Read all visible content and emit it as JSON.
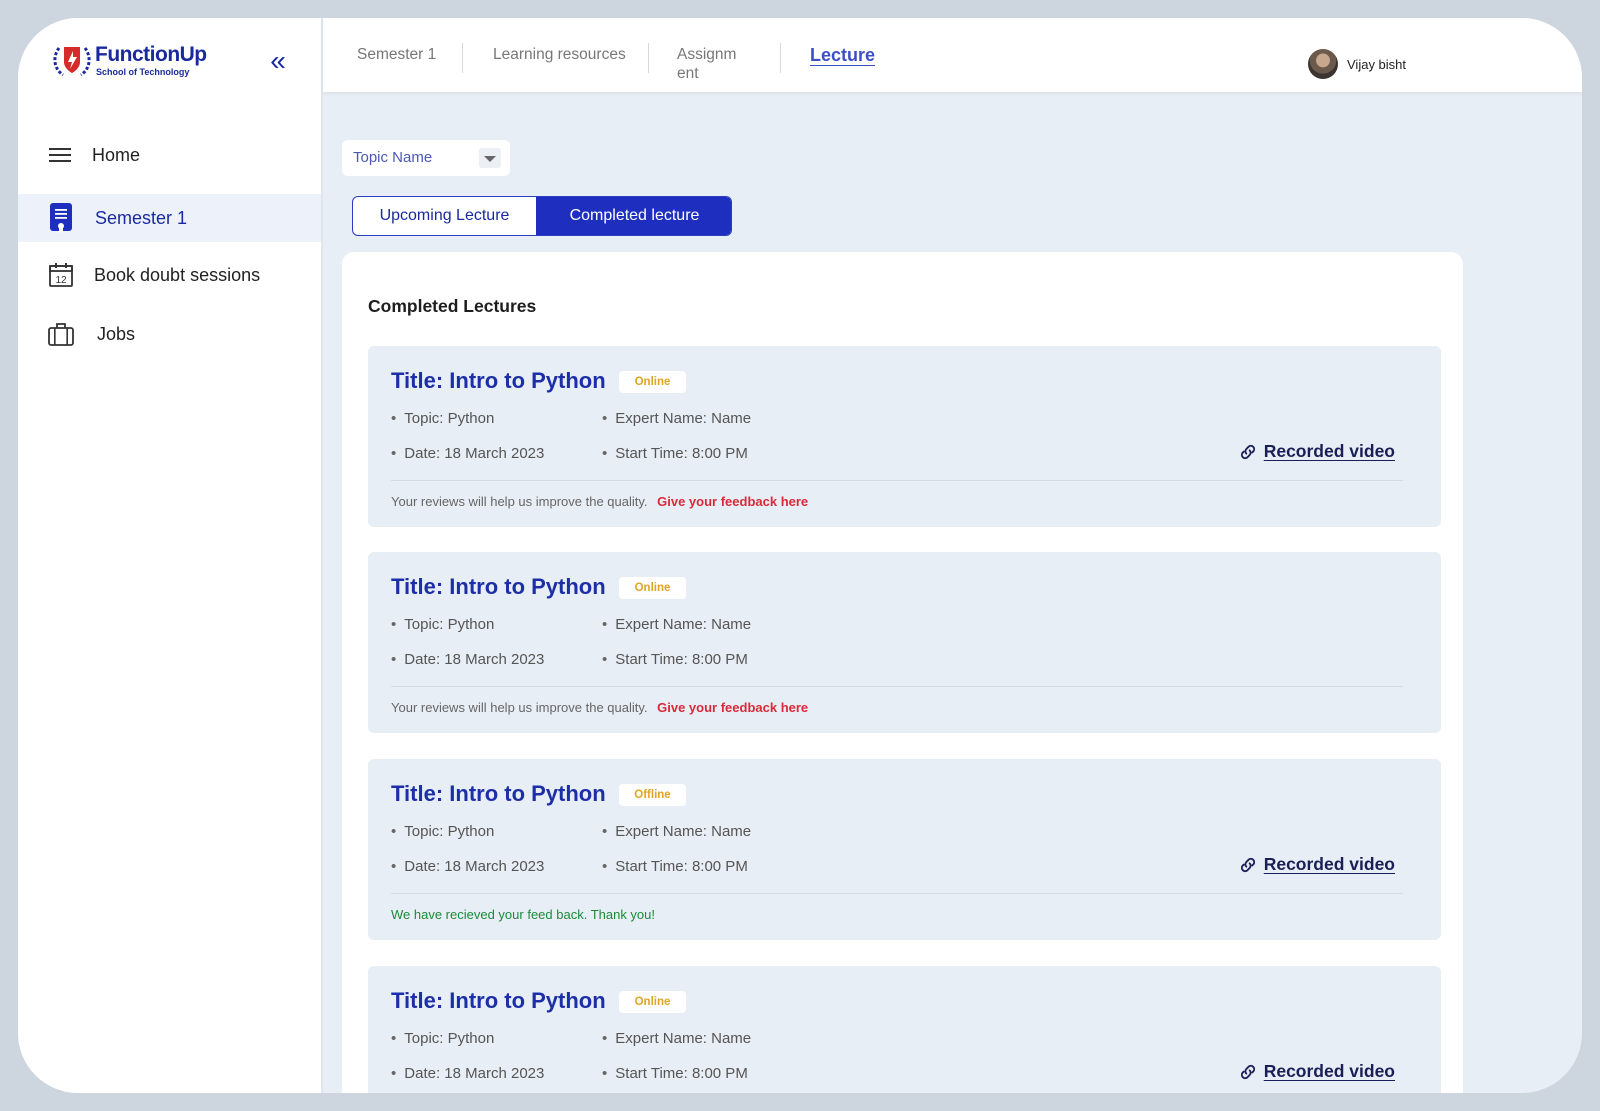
{
  "brand": {
    "name": "FunctionUp",
    "tagline": "School of Technology"
  },
  "sidebar": {
    "collapse_symbol": "«",
    "items": [
      {
        "label": "Home",
        "icon": "menu-icon",
        "active": false
      },
      {
        "label": "Semester 1",
        "icon": "semester-icon",
        "active": true
      },
      {
        "label": "Book doubt sessions",
        "icon": "calendar-icon",
        "active": false
      },
      {
        "label": "Jobs",
        "icon": "briefcase-icon",
        "active": false
      }
    ],
    "calendar_day": "12"
  },
  "topnav": {
    "tabs": [
      {
        "label": "Semester 1",
        "active": false
      },
      {
        "label": "Learning resources",
        "active": false
      },
      {
        "label": "Assignm\nent",
        "active": false
      },
      {
        "label": "Lecture",
        "active": true
      }
    ],
    "user": {
      "name": "Vijay bisht"
    }
  },
  "filter": {
    "topic_label": "Topic Name"
  },
  "toggle": {
    "upcoming": "Upcoming Lecture",
    "completed": "Completed lecture",
    "selected": "completed"
  },
  "section_title": "Completed Lectures",
  "lectures": [
    {
      "title": "Title: Intro to Python",
      "mode": "Online",
      "topic": "Topic: Python",
      "expert": "Expert Name: Name",
      "date": "Date: 18 March 2023",
      "time": "Start Time: 8:00 PM",
      "recorded_label": "Recorded video",
      "feedback_note": "Your reviews will help us improve the quality.",
      "feedback_link": "Give your feedback here"
    },
    {
      "title": "Title: Intro to Python",
      "mode": "Online",
      "topic": "Topic: Python",
      "expert": "Expert Name: Name",
      "date": "Date: 18 March 2023",
      "time": "Start Time: 8:00 PM",
      "feedback_note": "Your reviews will help us improve the quality.",
      "feedback_link": "Give your feedback here"
    },
    {
      "title": "Title: Intro to Python",
      "mode": "Offline",
      "topic": "Topic: Python",
      "expert": "Expert Name: Name",
      "date": "Date: 18 March 2023",
      "time": "Start Time: 8:00 PM",
      "recorded_label": "Recorded video",
      "feedback_thanks": "We have recieved your feed back. Thank you!"
    },
    {
      "title": "Title: Intro to Python",
      "mode": "Online",
      "topic": "Topic: Python",
      "expert": "Expert Name: Name",
      "date": "Date: 18 March 2023",
      "time": "Start Time: 8:00 PM",
      "recorded_label": "Recorded video"
    }
  ],
  "colors": {
    "brand_blue": "#1a2a9e",
    "toggle_active": "#1e2fc0",
    "badge_text": "#e0a521",
    "feedback_link": "#d92a3a",
    "feedback_thanks": "#1c8a3a"
  }
}
